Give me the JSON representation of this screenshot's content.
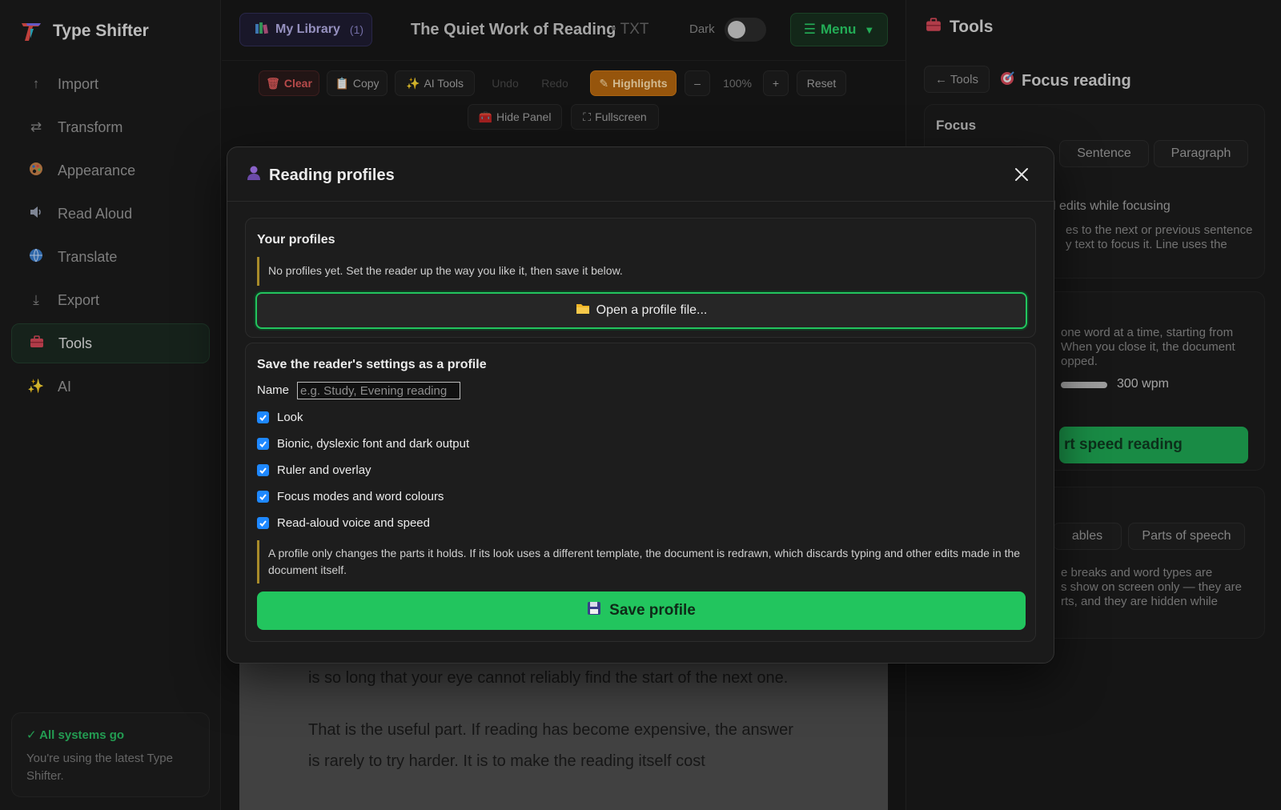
{
  "app": {
    "name": "Type Shifter",
    "accent": "#22c55e"
  },
  "sidebar": {
    "items": [
      {
        "label": "Import",
        "icon": "arrow-up-icon"
      },
      {
        "label": "Transform",
        "icon": "swap-arrows-icon"
      },
      {
        "label": "Appearance",
        "icon": "palette-icon"
      },
      {
        "label": "Read Aloud",
        "icon": "speaker-icon"
      },
      {
        "label": "Translate",
        "icon": "globe-icon"
      },
      {
        "label": "Export",
        "icon": "download-icon"
      },
      {
        "label": "Tools",
        "icon": "toolbox-icon",
        "active": true
      },
      {
        "label": "AI",
        "icon": "sparkles-icon"
      }
    ],
    "status": {
      "title": "✓ All systems go",
      "text": "You're using the latest Type Shifter."
    }
  },
  "header": {
    "library_label": "My Library",
    "library_count": "(1)",
    "doc_title": "The Quiet Work of Reading",
    "doc_ext": "• TXT",
    "dark_label": "Dark",
    "menu_label": "Menu"
  },
  "toolbar": {
    "clear": "Clear",
    "copy": "Copy",
    "ai_tools": "AI Tools",
    "undo": "Undo",
    "redo": "Redo",
    "highlights": "Highlights",
    "zoom_out": "–",
    "zoom_level": "100%",
    "zoom_in": "+",
    "reset": "Reset",
    "hide_panel": "Hide Panel",
    "fullscreen": "Fullscreen"
  },
  "document": {
    "paragraphs": [
      "is so long that your eye cannot reliably find the start of the next one.",
      "That is the useful part. If reading has become expensive, the answer is rarely to try harder. It is to make the reading itself cost"
    ]
  },
  "right_panel": {
    "title": "Tools",
    "back_label": "← Tools",
    "subtitle": "Focus reading",
    "focus_label": "Focus",
    "focus_modes": [
      "Sentence",
      "Paragraph"
    ],
    "edits_text": "l edits while focusing",
    "hint_1a": "es to the next or previous sentence",
    "hint_1b": "y text to focus it. Line uses the",
    "hint_2a": "one word at a time, starting from",
    "hint_2b": "When you close it, the document",
    "hint_2c": "opped.",
    "wpm": "300 wpm",
    "start_label": "rt speed reading",
    "color_modes": [
      "ables",
      "Parts of speech"
    ],
    "hint_3a": "e breaks and word types are",
    "hint_3b": "s show on screen only — they are",
    "hint_3c": "rts, and they are hidden while"
  },
  "modal": {
    "title": "Reading profiles",
    "your_profiles": {
      "title": "Your profiles",
      "empty_note": "No profiles yet. Set the reader up the way you like it, then save it below.",
      "open_label": "Open a profile file..."
    },
    "save_section": {
      "title": "Save the reader's settings as a profile",
      "name_label": "Name",
      "name_placeholder": "e.g. Study, Evening reading",
      "options": [
        {
          "label": "Look",
          "checked": true
        },
        {
          "label": "Bionic, dyslexic font and dark output",
          "checked": true
        },
        {
          "label": "Ruler and overlay",
          "checked": true
        },
        {
          "label": "Focus modes and word colours",
          "checked": true
        },
        {
          "label": "Read-aloud voice and speed",
          "checked": true
        }
      ],
      "warning": "A profile only changes the parts it holds. If its look uses a different template, the document is redrawn, which discards typing and other edits made in the document itself.",
      "save_label": "Save profile"
    }
  }
}
